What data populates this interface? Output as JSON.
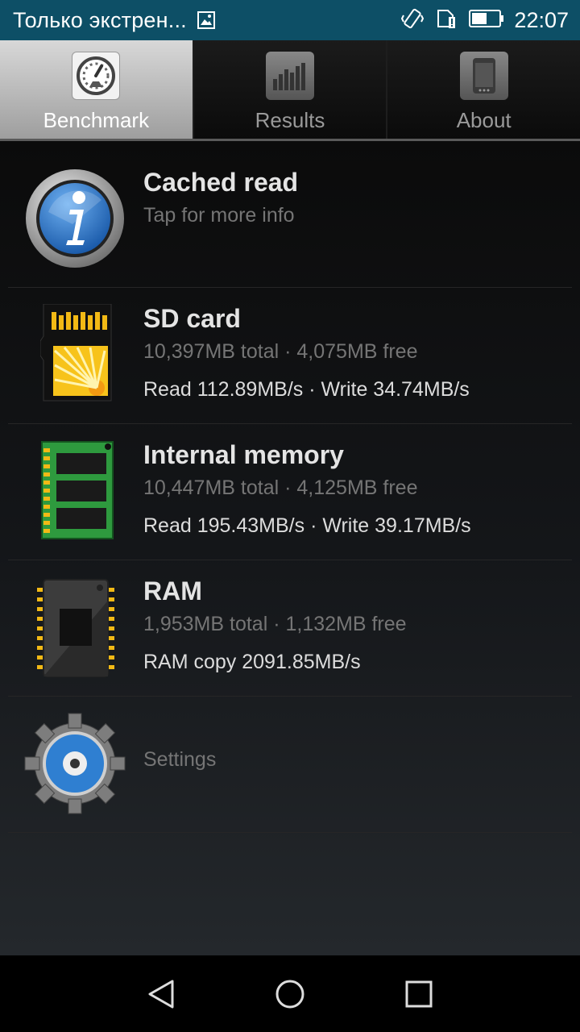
{
  "status_bar": {
    "carrier_text": "Только экстрен...",
    "time": "22:07",
    "icons": [
      "image-icon",
      "vibrate-icon",
      "sim-alert-icon",
      "battery-icon"
    ]
  },
  "tabs": [
    {
      "label": "Benchmark",
      "icon": "speedometer-icon",
      "active": true
    },
    {
      "label": "Results",
      "icon": "bar-chart-icon",
      "active": false
    },
    {
      "label": "About",
      "icon": "phone-icon",
      "active": false
    }
  ],
  "items": [
    {
      "title": "Cached read",
      "subtitle": "Tap for more info",
      "icon": "info-icon"
    },
    {
      "title": "SD card",
      "subtitle": "10,397MB total · 4,075MB free",
      "speed": "Read 112.89MB/s · Write 34.74MB/s",
      "icon": "sd-card-icon"
    },
    {
      "title": "Internal memory",
      "subtitle": "10,447MB total · 4,125MB free",
      "speed": "Read 195.43MB/s · Write 39.17MB/s",
      "icon": "memory-chip-icon"
    },
    {
      "title": "RAM",
      "subtitle": "1,953MB total · 1,132MB free",
      "speed": "RAM copy 2091.85MB/s",
      "icon": "ram-chip-icon"
    },
    {
      "title": "Settings",
      "icon": "gear-icon"
    }
  ],
  "nav": [
    "back-icon",
    "home-icon",
    "recents-icon"
  ],
  "colors": {
    "status_bar": "#0d4f66",
    "accent_blue": "#2f7fd1",
    "sd_yellow": "#f7c31b",
    "chip_green": "#2e9a3e"
  }
}
